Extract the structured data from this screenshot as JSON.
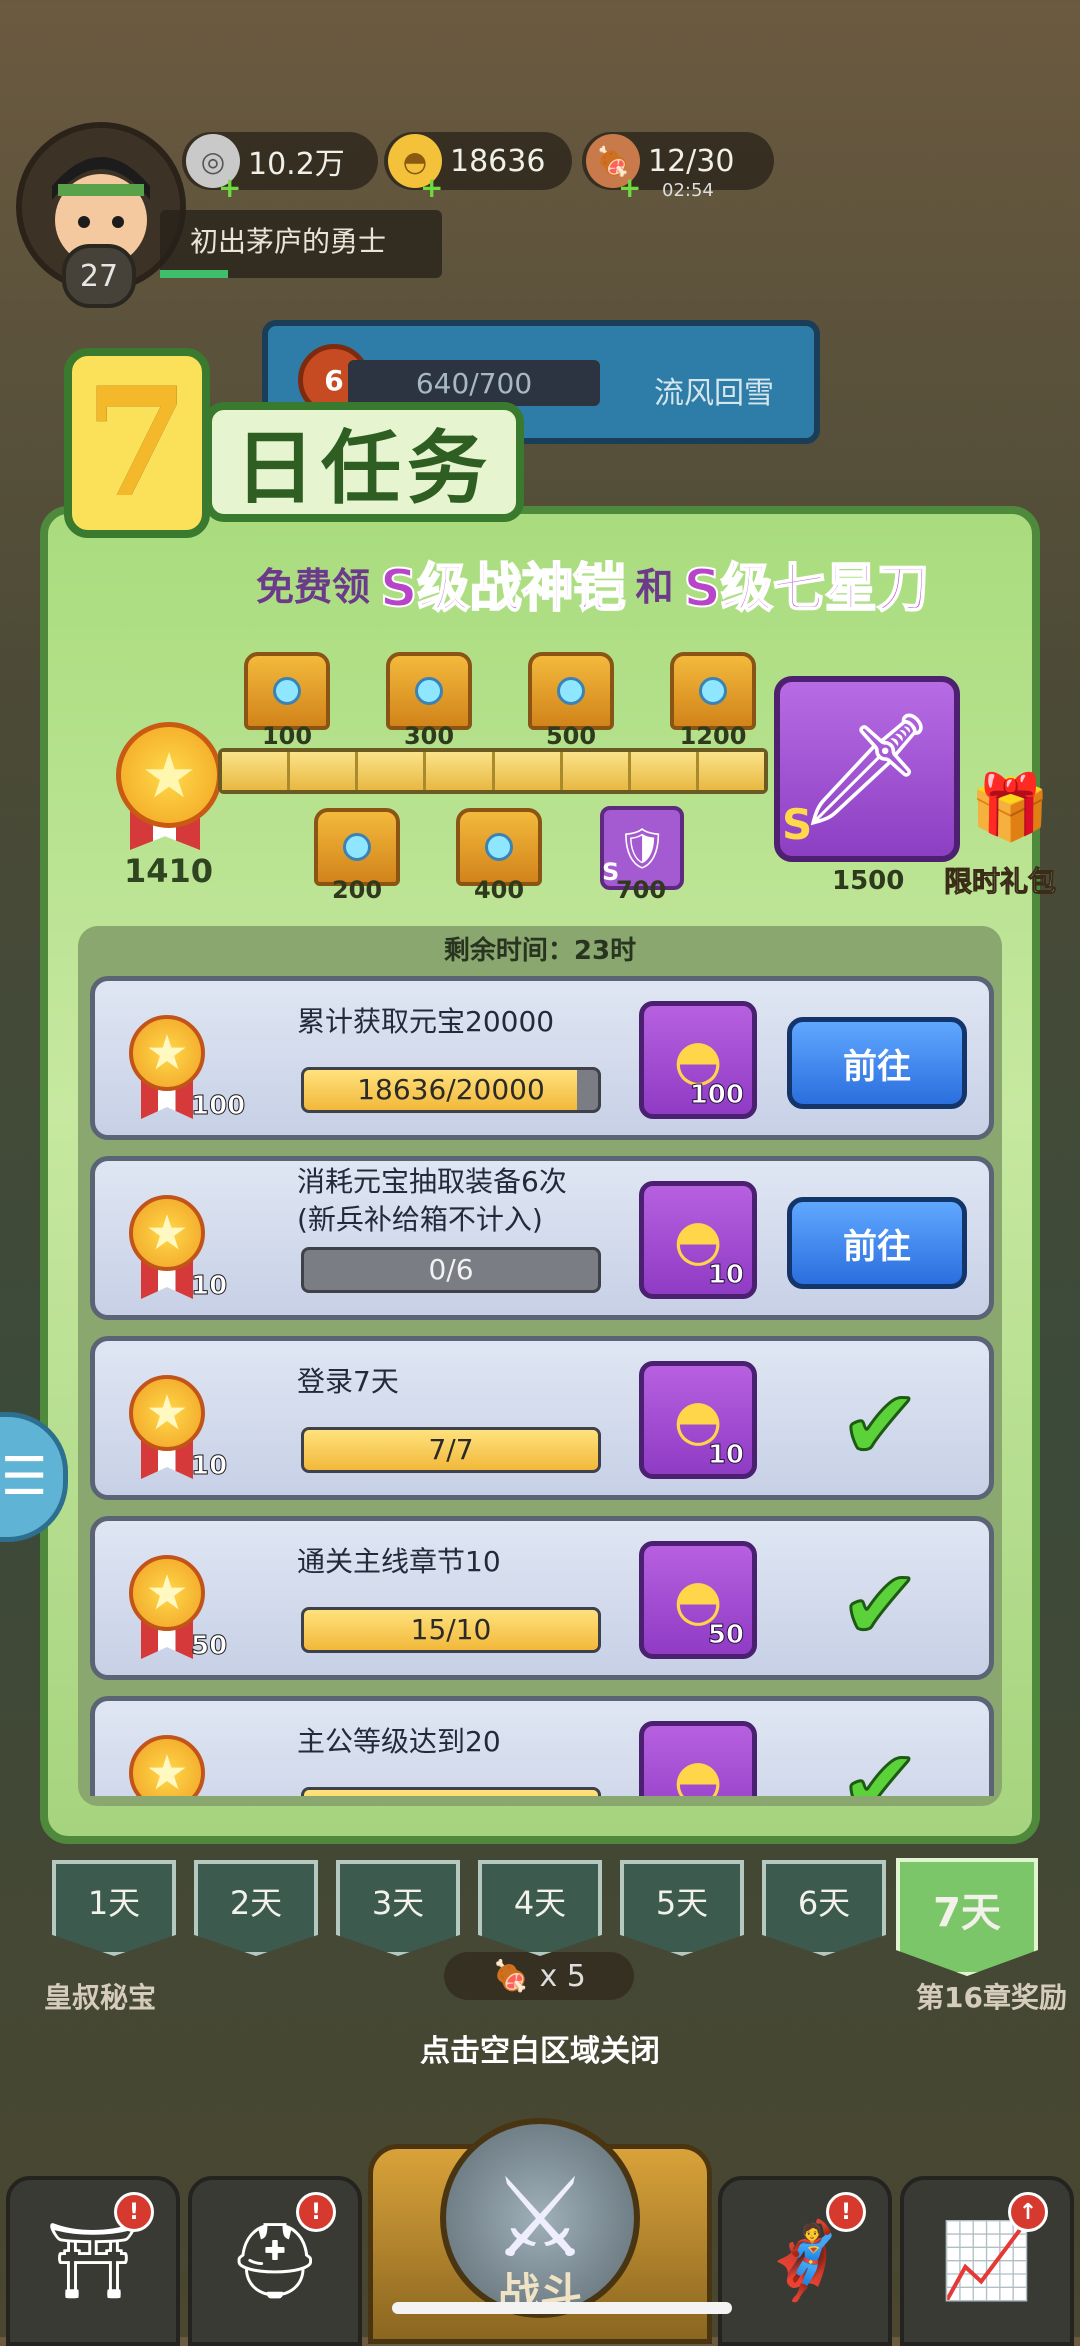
{
  "hud": {
    "level": "27",
    "title": "初出茅庐的勇士",
    "resources": [
      {
        "icon": "coin-icon",
        "value": "10.2万"
      },
      {
        "icon": "gold-ingot-icon",
        "value": "18636"
      },
      {
        "icon": "meat-icon",
        "value": "12/30",
        "timer": "02:54"
      }
    ],
    "boss": {
      "badge": "6",
      "progress": "640/700",
      "name": "流风回雪"
    }
  },
  "header": {
    "seven": "7",
    "word": "日任务"
  },
  "headline": {
    "p1": "免费领",
    "item1": "S级战神铠",
    "p2": "和",
    "item2": "S级七星刀"
  },
  "milestones": {
    "total_points": "1410",
    "top": [
      "100",
      "300",
      "500",
      "1200"
    ],
    "bottom": [
      "200",
      "400",
      "700"
    ],
    "armor_grade": "S",
    "final_grade": "S",
    "final_value": "1500",
    "gift_label": "限时礼包"
  },
  "remaining": "剩余时间：23时",
  "tasks": [
    {
      "points": "100",
      "title": "累计获取元宝20000",
      "progress": "18636/20000",
      "fill": 0.93,
      "reward": "100",
      "action": "前往",
      "done": false
    },
    {
      "points": "10",
      "title": "消耗元宝抽取装备6次 (新兵补给箱不计入)",
      "progress": "0/6",
      "fill": 0,
      "reward": "10",
      "action": "前往",
      "done": false
    },
    {
      "points": "10",
      "title": "登录7天",
      "progress": "7/7",
      "fill": 1,
      "reward": "10",
      "action": "",
      "done": true
    },
    {
      "points": "50",
      "title": "通关主线章节10",
      "progress": "15/10",
      "fill": 1,
      "reward": "50",
      "action": "",
      "done": true
    },
    {
      "points": "",
      "title": "主公等级达到20",
      "progress": "",
      "fill": 1,
      "reward": "",
      "action": "",
      "done": true
    }
  ],
  "days": [
    "1天",
    "2天",
    "3天",
    "4天",
    "5天",
    "6天",
    "7天"
  ],
  "active_day": "7天",
  "bg_labels": {
    "left": "皇叔秘宝",
    "right": "第16章奖励"
  },
  "meat_cost": "x 5",
  "close_hint": "点击空白区域关闭",
  "battle_label": "战斗",
  "colors": {
    "panel": "#a9dc7e",
    "accent": "#b845c9",
    "go_button": "#2b6ede",
    "check": "#5bd23a"
  }
}
